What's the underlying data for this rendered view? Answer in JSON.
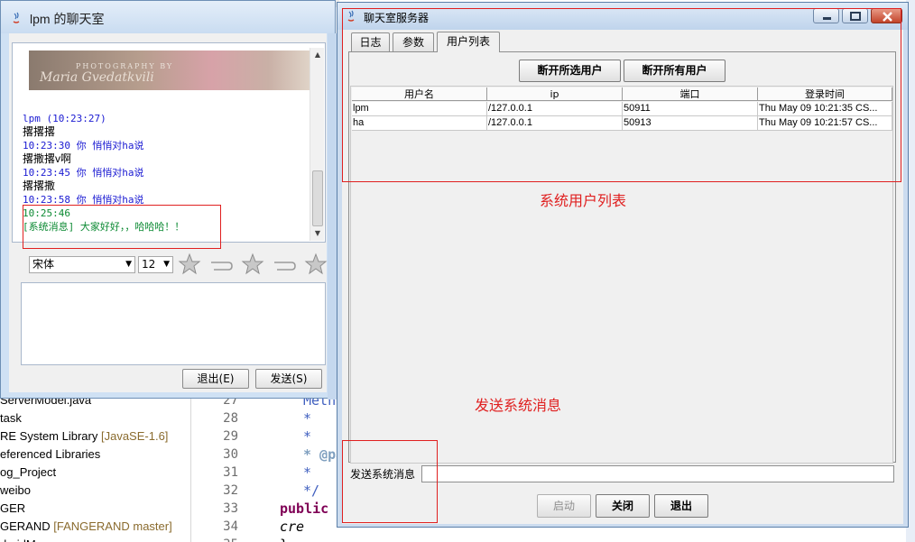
{
  "client": {
    "title": "lpm 的聊天室",
    "banner_line": "PHOTOGRAPHY BY",
    "banner_signature": "Maria Gvedatkvili",
    "messages": [
      {
        "text": "lpm  (10:23:27)",
        "color": "blue"
      },
      {
        "text": "撂撂撂",
        "color": "black"
      },
      {
        "text": "10:23:30    你  悄悄对ha说",
        "color": "blue"
      },
      {
        "text": "撂撒撂v啊",
        "color": "black"
      },
      {
        "text": "10:23:45    你  悄悄对ha说",
        "color": "blue"
      },
      {
        "text": "撂撂撒",
        "color": "black"
      },
      {
        "text": "10:23:58    你  悄悄对ha说",
        "color": "blue"
      },
      {
        "text": "10:25:46",
        "color": "green"
      },
      {
        "text": "[系统消息]  大家好好，，哈哈哈！！",
        "color": "green"
      }
    ],
    "font_select": "宋体",
    "size_select": "12",
    "exit_button": "退出(E)",
    "send_button": "发送(S)"
  },
  "server": {
    "title": "聊天室服务器",
    "tabs": [
      {
        "label": "日志",
        "active": false
      },
      {
        "label": "参数",
        "active": false
      },
      {
        "label": "用户列表",
        "active": true
      }
    ],
    "disconnect_selected": "断开所选用户",
    "disconnect_all": "断开所有用户",
    "columns": [
      "用户名",
      "ip",
      "端口",
      "登录时间"
    ],
    "rows": [
      [
        "lpm",
        "/127.0.0.1",
        "50911",
        "Thu May 09 10:21:35 CS..."
      ],
      [
        "ha",
        "/127.0.0.1",
        "50913",
        "Thu May 09 10:21:57 CS..."
      ]
    ],
    "system_message_label": "发送系统消息",
    "system_message_value": "",
    "start_button": "启动",
    "close_button": "关闭",
    "exit_button": "退出"
  },
  "annotations": {
    "user_list_note": "系统用户列表",
    "send_message_note": "发送系统消息"
  },
  "workspace": {
    "tree": [
      {
        "text": "ServerModel.java",
        "dim": ""
      },
      {
        "text": "task",
        "dim": ""
      },
      {
        "text": "RE System Library ",
        "dim": "[JavaSE-1.6]"
      },
      {
        "text": "eferenced Libraries",
        "dim": ""
      },
      {
        "text": "og_Project",
        "dim": ""
      },
      {
        "text": "weibo",
        "dim": ""
      },
      {
        "text": "GER",
        "dim": ""
      },
      {
        "text": "GERAND ",
        "dim": "[FANGERAND master]"
      },
      {
        "text": "droidMan",
        "dim": ""
      }
    ],
    "line_numbers": [
      "27",
      "28",
      "29",
      "30",
      "31",
      "32",
      "33",
      "34",
      "35"
    ],
    "code": [
      {
        "text": "Meth",
        "cls": "cm"
      },
      {
        "text": "*",
        "cls": "cm"
      },
      {
        "text": "*",
        "cls": "cm"
      },
      {
        "text": "* @par",
        "cls": "tag"
      },
      {
        "text": "*",
        "cls": "cm"
      },
      {
        "text": "*/",
        "cls": "cm"
      },
      {
        "text": "public",
        "cls": "kw"
      },
      {
        "text": "    cre",
        "cls": "it"
      },
      {
        "text": "}",
        "cls": "plain"
      }
    ]
  },
  "colors": {
    "annotation_red": "#e02020",
    "chat_blue": "#1a1ad2",
    "chat_green": "#0c8a33"
  }
}
